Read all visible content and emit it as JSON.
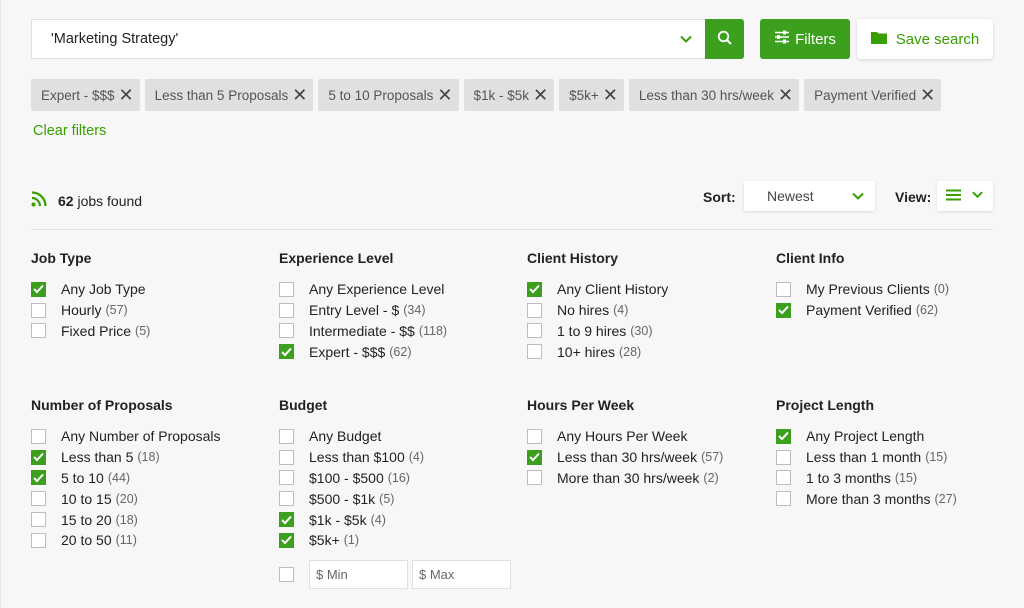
{
  "search": {
    "value": "'Marketing Strategy'",
    "filters_label": "Filters",
    "save_label": "Save search"
  },
  "chips": [
    {
      "label": "Expert - $$$"
    },
    {
      "label": "Less than 5 Proposals"
    },
    {
      "label": "5 to 10 Proposals"
    },
    {
      "label": "$1k - $5k"
    },
    {
      "label": "$5k+"
    },
    {
      "label": "Less than 30 hrs/week"
    },
    {
      "label": "Payment Verified"
    }
  ],
  "clear_filters": "Clear filters",
  "results": {
    "count": "62",
    "suffix": "jobs found"
  },
  "sort": {
    "label": "Sort:",
    "value": "Newest"
  },
  "view": {
    "label": "View:"
  },
  "colors": {
    "accent": "#37a000",
    "chip_bg": "#e0e0e0"
  },
  "groups": [
    {
      "title": "Job Type",
      "options": [
        {
          "label": "Any Job Type",
          "count": "",
          "checked": true
        },
        {
          "label": "Hourly",
          "count": "(57)",
          "checked": false
        },
        {
          "label": "Fixed Price",
          "count": "(5)",
          "checked": false
        }
      ]
    },
    {
      "title": "Experience Level",
      "options": [
        {
          "label": "Any Experience Level",
          "count": "",
          "checked": false
        },
        {
          "label": "Entry Level - $",
          "count": "(34)",
          "checked": false
        },
        {
          "label": "Intermediate - $$",
          "count": "(118)",
          "checked": false
        },
        {
          "label": "Expert - $$$",
          "count": "(62)",
          "checked": true
        }
      ]
    },
    {
      "title": "Client History",
      "options": [
        {
          "label": "Any Client History",
          "count": "",
          "checked": true
        },
        {
          "label": "No hires",
          "count": "(4)",
          "checked": false
        },
        {
          "label": "1 to 9 hires",
          "count": "(30)",
          "checked": false
        },
        {
          "label": "10+ hires",
          "count": "(28)",
          "checked": false
        }
      ]
    },
    {
      "title": "Client Info",
      "options": [
        {
          "label": "My Previous Clients",
          "count": "(0)",
          "checked": false
        },
        {
          "label": "Payment Verified",
          "count": "(62)",
          "checked": true
        }
      ]
    },
    {
      "title": "Number of Proposals",
      "options": [
        {
          "label": "Any Number of Proposals",
          "count": "",
          "checked": false
        },
        {
          "label": "Less than 5",
          "count": "(18)",
          "checked": true
        },
        {
          "label": "5 to 10",
          "count": "(44)",
          "checked": true
        },
        {
          "label": "10 to 15",
          "count": "(20)",
          "checked": false
        },
        {
          "label": "15 to 20",
          "count": "(18)",
          "checked": false
        },
        {
          "label": "20 to 50",
          "count": "(11)",
          "checked": false
        }
      ]
    },
    {
      "title": "Budget",
      "options": [
        {
          "label": "Any Budget",
          "count": "",
          "checked": false
        },
        {
          "label": "Less than $100",
          "count": "(4)",
          "checked": false
        },
        {
          "label": "$100 - $500",
          "count": "(16)",
          "checked": false
        },
        {
          "label": "$500 - $1k",
          "count": "(5)",
          "checked": false
        },
        {
          "label": "$1k - $5k",
          "count": "(4)",
          "checked": true
        },
        {
          "label": "$5k+",
          "count": "(1)",
          "checked": true
        }
      ],
      "min_placeholder": "$ Min",
      "max_placeholder": "$ Max"
    },
    {
      "title": "Hours Per Week",
      "options": [
        {
          "label": "Any Hours Per Week",
          "count": "",
          "checked": false
        },
        {
          "label": "Less than 30 hrs/week",
          "count": "(57)",
          "checked": true
        },
        {
          "label": "More than 30 hrs/week",
          "count": "(2)",
          "checked": false
        }
      ]
    },
    {
      "title": "Project Length",
      "options": [
        {
          "label": "Any Project Length",
          "count": "",
          "checked": true
        },
        {
          "label": "Less than 1 month",
          "count": "(15)",
          "checked": false
        },
        {
          "label": "1 to 3 months",
          "count": "(15)",
          "checked": false
        },
        {
          "label": "More than 3 months",
          "count": "(27)",
          "checked": false
        }
      ]
    }
  ]
}
